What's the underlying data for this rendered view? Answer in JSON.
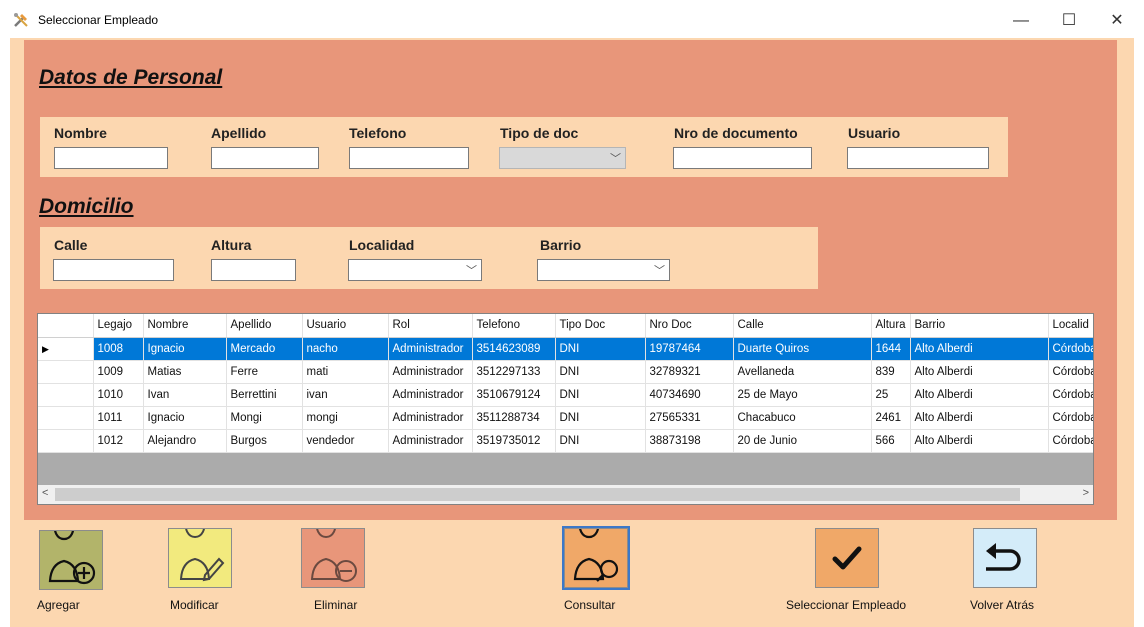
{
  "window": {
    "title": "Seleccionar Empleado",
    "minimize": "—",
    "maximize": "☐",
    "close": "✕"
  },
  "personal": {
    "heading": "Datos de Personal",
    "labels": {
      "nombre": "Nombre",
      "apellido": "Apellido",
      "telefono": "Telefono",
      "tipo_doc": "Tipo de doc",
      "nro_doc": "Nro de documento",
      "usuario": "Usuario"
    },
    "values": {
      "nombre": "",
      "apellido": "",
      "telefono": "",
      "tipo_doc": "",
      "nro_doc": "",
      "usuario": ""
    }
  },
  "domicilio": {
    "heading": "Domicilio",
    "labels": {
      "calle": "Calle",
      "altura": "Altura",
      "localidad": "Localidad",
      "barrio": "Barrio"
    },
    "values": {
      "calle": "",
      "altura": "",
      "localidad": "",
      "barrio": ""
    }
  },
  "grid": {
    "columns": [
      "Legajo",
      "Nombre",
      "Apellido",
      "Usuario",
      "Rol",
      "Telefono",
      "Tipo Doc",
      "Nro Doc",
      "Calle",
      "Altura",
      "Barrio",
      "Localid"
    ],
    "rows": [
      [
        "1008",
        "Ignacio",
        "Mercado",
        "nacho",
        "Administrador",
        "3514623089",
        "DNI",
        "19787464",
        "Duarte Quiros",
        "1644",
        "Alto Alberdi",
        "Córdoba"
      ],
      [
        "1009",
        "Matias",
        "Ferre",
        "mati",
        "Administrador",
        "3512297133",
        "DNI",
        "32789321",
        "Avellaneda",
        "839",
        "Alto Alberdi",
        "Córdoba"
      ],
      [
        "1010",
        "Ivan",
        "Berrettini",
        "ivan",
        "Administrador",
        "3510679124",
        "DNI",
        "40734690",
        "25 de Mayo",
        "25",
        "Alto Alberdi",
        "Córdoba"
      ],
      [
        "1011",
        "Ignacio",
        "Mongi",
        "mongi",
        "Administrador",
        "3511288734",
        "DNI",
        "27565331",
        "Chacabuco",
        "2461",
        "Alto Alberdi",
        "Córdoba"
      ],
      [
        "1012",
        "Alejandro",
        "Burgos",
        "vendedor",
        "Administrador",
        "3519735012",
        "DNI",
        "38873198",
        "20 de Junio",
        "566",
        "Alto Alberdi",
        "Córdoba"
      ]
    ],
    "selected_row": 0,
    "row_marker": "▶",
    "scroll_left": "<",
    "scroll_right": ">"
  },
  "toolbar": {
    "agregar": "Agregar",
    "modificar": "Modificar",
    "eliminar": "Eliminar",
    "consultar": "Consultar",
    "seleccionar": "Seleccionar Empleado",
    "volver": "Volver Atrás"
  },
  "colors": {
    "frame": "#fcd7b0",
    "panel": "#e8967a",
    "agregar": "#b2b46a",
    "modificar": "#f2ea7e",
    "eliminar": "#e8967a",
    "consultar": "#f0a868",
    "seleccionar": "#f0a868",
    "volver": "#d4ecf9",
    "selection": "#0078d7"
  }
}
